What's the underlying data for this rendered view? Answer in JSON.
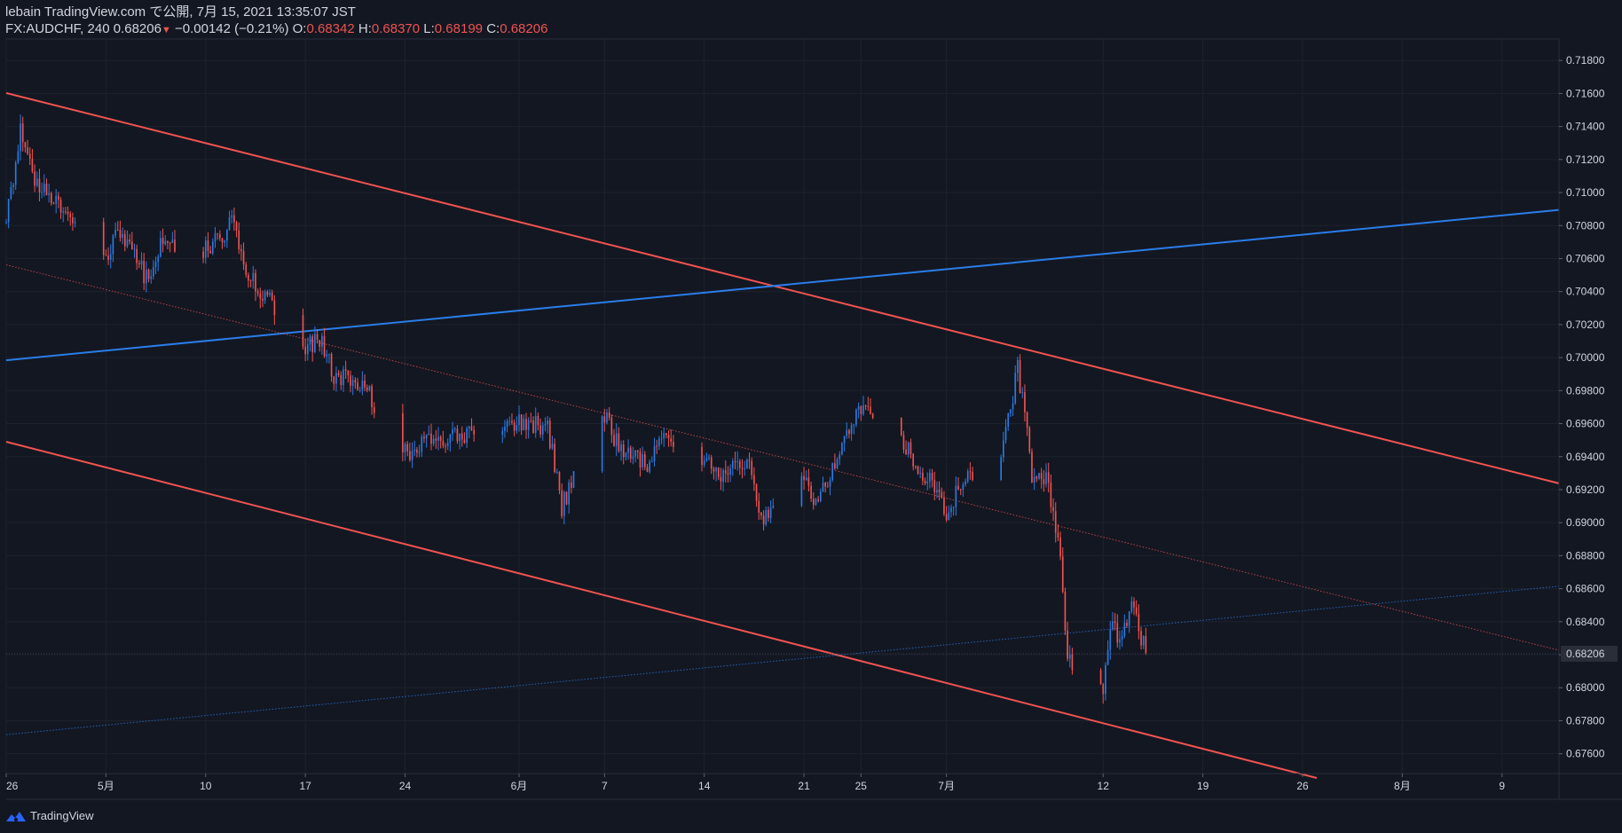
{
  "header": {
    "line1": "lebain TradingView.com で公開, 7月 15, 2021 13:35:07 JST",
    "symbol": "FX:AUDCHF, 240",
    "last": "0.68206",
    "change_arrow": "▼",
    "change": "−0.00142 (−0.21%)",
    "o_label": "O:",
    "o_value": "0.68342",
    "h_label": "H:",
    "h_value": "0.68370",
    "l_label": "L:",
    "l_value": "0.68199",
    "c_label": "C:",
    "c_value": "0.68206"
  },
  "footer": {
    "brand": "TradingView",
    "logo_icon": "tradingview-logo-icon"
  },
  "colors": {
    "background": "#131722",
    "up": "#2962ff",
    "up_candle": "#2a7ae2",
    "down": "#ef5350",
    "trend_blue": "#2b7de9",
    "trend_red": "#f05350",
    "grid": "#1e222d",
    "text": "#d1d4dc"
  },
  "chart_data": {
    "type": "candlestick",
    "symbol": "FX:AUDCHF",
    "interval": "240",
    "y_axis": {
      "position": "right",
      "ticks": [
        "0.71800",
        "0.71600",
        "0.71400",
        "0.71200",
        "0.71000",
        "0.70800",
        "0.70600",
        "0.70400",
        "0.70200",
        "0.70000",
        "0.69800",
        "0.69600",
        "0.69400",
        "0.69200",
        "0.69000",
        "0.68800",
        "0.68600",
        "0.68400",
        "0.68200",
        "0.68000",
        "0.67800",
        "0.67600"
      ],
      "tick_values": [
        0.718,
        0.716,
        0.714,
        0.712,
        0.71,
        0.708,
        0.706,
        0.704,
        0.702,
        0.7,
        0.698,
        0.696,
        0.694,
        0.692,
        0.69,
        0.688,
        0.686,
        0.684,
        0.682,
        0.68,
        0.678,
        0.676
      ],
      "range": [
        0.6748,
        0.7193
      ],
      "last_price_label": "0.68206",
      "last_price": 0.68206
    },
    "x_axis": {
      "ticks": [
        {
          "label": "26",
          "date": "2021-04-26"
        },
        {
          "label": "5月",
          "date": "2021-05-03"
        },
        {
          "label": "10",
          "date": "2021-05-10"
        },
        {
          "label": "17",
          "date": "2021-05-17"
        },
        {
          "label": "24",
          "date": "2021-05-24"
        },
        {
          "label": "6月",
          "date": "2021-06-01"
        },
        {
          "label": "7",
          "date": "2021-06-07"
        },
        {
          "label": "14",
          "date": "2021-06-14"
        },
        {
          "label": "21",
          "date": "2021-06-21"
        },
        {
          "label": "25",
          "date": "2021-06-25"
        },
        {
          "label": "7月",
          "date": "2021-07-01"
        },
        {
          "label": "12",
          "date": "2021-07-12"
        },
        {
          "label": "19",
          "date": "2021-07-19"
        },
        {
          "label": "26",
          "date": "2021-07-26"
        },
        {
          "label": "8月",
          "date": "2021-08-02"
        },
        {
          "label": "9",
          "date": "2021-08-09"
        }
      ],
      "range": [
        "2021-04-26",
        "2021-08-13"
      ]
    },
    "path_anchors": [
      [
        "2021-04-26",
        0.7082
      ],
      [
        "2021-04-27",
        0.7136
      ],
      [
        "2021-04-28",
        0.7108
      ],
      [
        "2021-04-30",
        0.709
      ],
      [
        "2021-05-03",
        0.706
      ],
      [
        "2021-05-04",
        0.7078
      ],
      [
        "2021-05-06",
        0.7045
      ],
      [
        "2021-05-07",
        0.7072
      ],
      [
        "2021-05-10",
        0.7065
      ],
      [
        "2021-05-12",
        0.7082
      ],
      [
        "2021-05-13",
        0.705
      ],
      [
        "2021-05-14",
        0.704
      ],
      [
        "2021-05-17",
        0.7006
      ],
      [
        "2021-05-18",
        0.7012
      ],
      [
        "2021-05-19",
        0.699
      ],
      [
        "2021-05-21",
        0.6984
      ],
      [
        "2021-05-24",
        0.6942
      ],
      [
        "2021-05-26",
        0.695
      ],
      [
        "2021-05-28",
        0.6952
      ],
      [
        "2021-06-01",
        0.696
      ],
      [
        "2021-06-03",
        0.6958
      ],
      [
        "2021-06-04",
        0.691
      ],
      [
        "2021-06-07",
        0.6965
      ],
      [
        "2021-06-08",
        0.6945
      ],
      [
        "2021-06-10",
        0.6935
      ],
      [
        "2021-06-11",
        0.695
      ],
      [
        "2021-06-14",
        0.694
      ],
      [
        "2021-06-15",
        0.6925
      ],
      [
        "2021-06-17",
        0.6938
      ],
      [
        "2021-06-18",
        0.69
      ],
      [
        "2021-06-21",
        0.6925
      ],
      [
        "2021-06-22",
        0.691
      ],
      [
        "2021-06-23",
        0.6935
      ],
      [
        "2021-06-24",
        0.6955
      ],
      [
        "2021-06-25",
        0.6968
      ],
      [
        "2021-06-28",
        0.695
      ],
      [
        "2021-06-29",
        0.6928
      ],
      [
        "2021-06-30",
        0.6925
      ],
      [
        "2021-07-01",
        0.6905
      ],
      [
        "2021-07-02",
        0.6922
      ],
      [
        "2021-07-05",
        0.6945
      ],
      [
        "2021-07-06",
        0.6995
      ],
      [
        "2021-07-07",
        0.693
      ],
      [
        "2021-07-08",
        0.6928
      ],
      [
        "2021-07-09",
        0.688
      ],
      [
        "2021-07-09.5",
        0.682
      ],
      [
        "2021-07-12",
        0.6795
      ],
      [
        "2021-07-12.5",
        0.684
      ],
      [
        "2021-07-13",
        0.683
      ],
      [
        "2021-07-14",
        0.685
      ],
      [
        "2021-07-15",
        0.68206
      ]
    ],
    "trend_lines": [
      {
        "style": "solid",
        "color": "red",
        "from": [
          "2021-04-26",
          0.71603
        ],
        "to": [
          "2021-08-13",
          0.69238
        ]
      },
      {
        "style": "solid",
        "color": "red",
        "from": [
          "2021-04-26",
          0.6949
        ],
        "to": [
          "2021-07-27",
          0.67453
        ]
      },
      {
        "style": "solid",
        "color": "blue",
        "from": [
          "2021-04-26",
          0.69984
        ],
        "to": [
          "2021-08-13",
          0.70895
        ]
      },
      {
        "style": "dotted",
        "color": "blue",
        "from": [
          "2021-04-26",
          0.67716
        ],
        "to": [
          "2021-08-13",
          0.68615
        ]
      },
      {
        "style": "dotted",
        "color": "red",
        "from": [
          "2021-04-26",
          0.70562
        ],
        "to": [
          "2021-08-13",
          0.68227
        ]
      }
    ],
    "last_close": 0.68206,
    "last_bar": {
      "open": 0.68342,
      "high": 0.6837,
      "low": 0.68199,
      "close": 0.68206
    }
  }
}
